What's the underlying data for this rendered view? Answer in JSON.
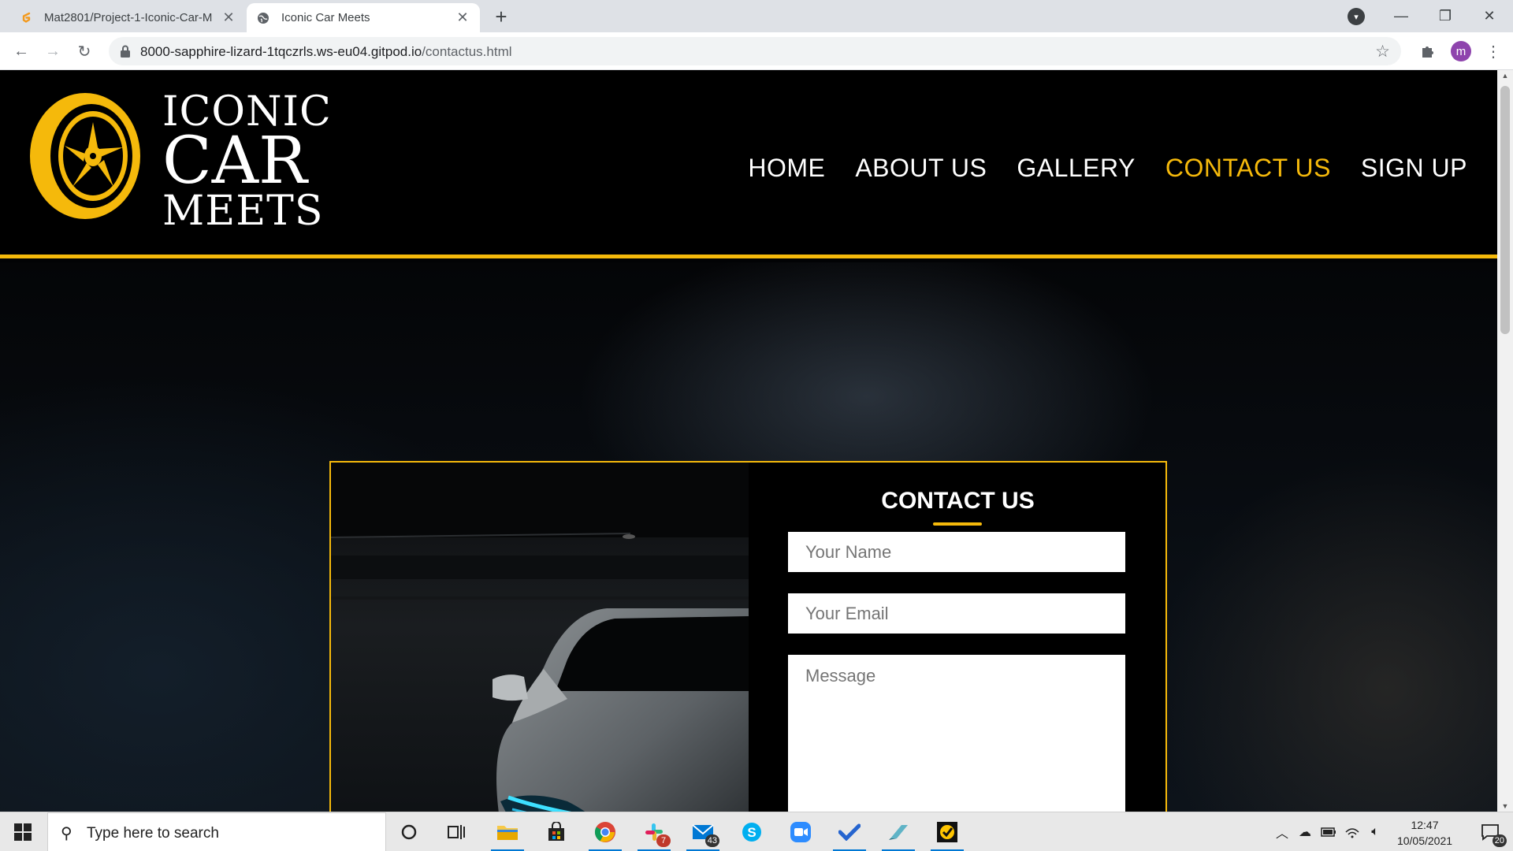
{
  "browser": {
    "tabs": [
      {
        "title": "Mat2801/Project-1-Iconic-Car-M",
        "icon": "gitpod-icon",
        "active": false
      },
      {
        "title": "Iconic Car Meets",
        "icon": "globe-icon",
        "active": true
      }
    ],
    "new_tab": "+",
    "url_host": "8000-sapphire-lizard-1tqczrls.ws-eu04.gitpod.io",
    "url_path": "/contactus.html",
    "profile_initial": "m"
  },
  "site": {
    "logo": {
      "line1": "ICONIC",
      "line2": "CAR",
      "line3": "MEETS"
    },
    "nav": [
      {
        "label": "HOME",
        "active": false
      },
      {
        "label": "ABOUT US",
        "active": false
      },
      {
        "label": "GALLERY",
        "active": false
      },
      {
        "label": "CONTACT US",
        "active": true
      },
      {
        "label": "SIGN UP",
        "active": false
      }
    ],
    "accent_color": "#f5b90b",
    "contact": {
      "title": "CONTACT US",
      "name_placeholder": "Your Name",
      "email_placeholder": "Your Email",
      "message_placeholder": "Message"
    }
  },
  "taskbar": {
    "search_placeholder": "Type here to search",
    "apps": [
      {
        "name": "cortana",
        "icon": "circle-icon"
      },
      {
        "name": "task-view",
        "icon": "task-view-icon"
      },
      {
        "name": "file-explorer",
        "icon": "folder-icon"
      },
      {
        "name": "store",
        "icon": "store-icon"
      },
      {
        "name": "chrome",
        "icon": "chrome-icon"
      },
      {
        "name": "slack",
        "icon": "slack-icon",
        "badge": "7"
      },
      {
        "name": "mail",
        "icon": "mail-icon",
        "badge": "43"
      },
      {
        "name": "skype",
        "icon": "skype-icon"
      },
      {
        "name": "zoom",
        "icon": "zoom-icon"
      },
      {
        "name": "todo",
        "icon": "checkmark-icon"
      },
      {
        "name": "app",
        "icon": "pen-icon"
      },
      {
        "name": "norton",
        "icon": "norton-icon"
      }
    ],
    "time": "12:47",
    "date": "10/05/2021",
    "notifications": "20"
  }
}
